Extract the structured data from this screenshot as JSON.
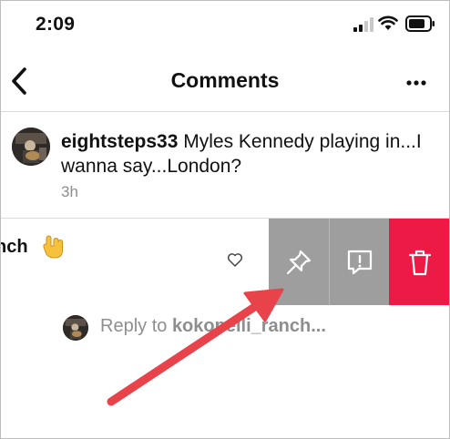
{
  "status_bar": {
    "time": "2:09"
  },
  "header": {
    "title": "Comments",
    "back_icon": "chevron-left-icon",
    "more_icon": "more-horizontal-icon"
  },
  "caption": {
    "username": "eightsteps33",
    "text": "Myles Kennedy playing in...I wanna say...London?",
    "time": "3h"
  },
  "comment": {
    "partial_text": "nch",
    "emoji": "rock-hand-emoji",
    "like_icon": "heart-icon"
  },
  "swipe_actions": {
    "pin_icon": "pin-icon",
    "report_icon": "report-icon",
    "delete_icon": "trash-icon",
    "colors": {
      "neutral": "#9e9e9e",
      "delete": "#ed1a46"
    }
  },
  "reply": {
    "prefix": "Reply to",
    "username": "kokopelli_ranch..."
  },
  "annotation": {
    "arrow_color": "#e8434b"
  }
}
